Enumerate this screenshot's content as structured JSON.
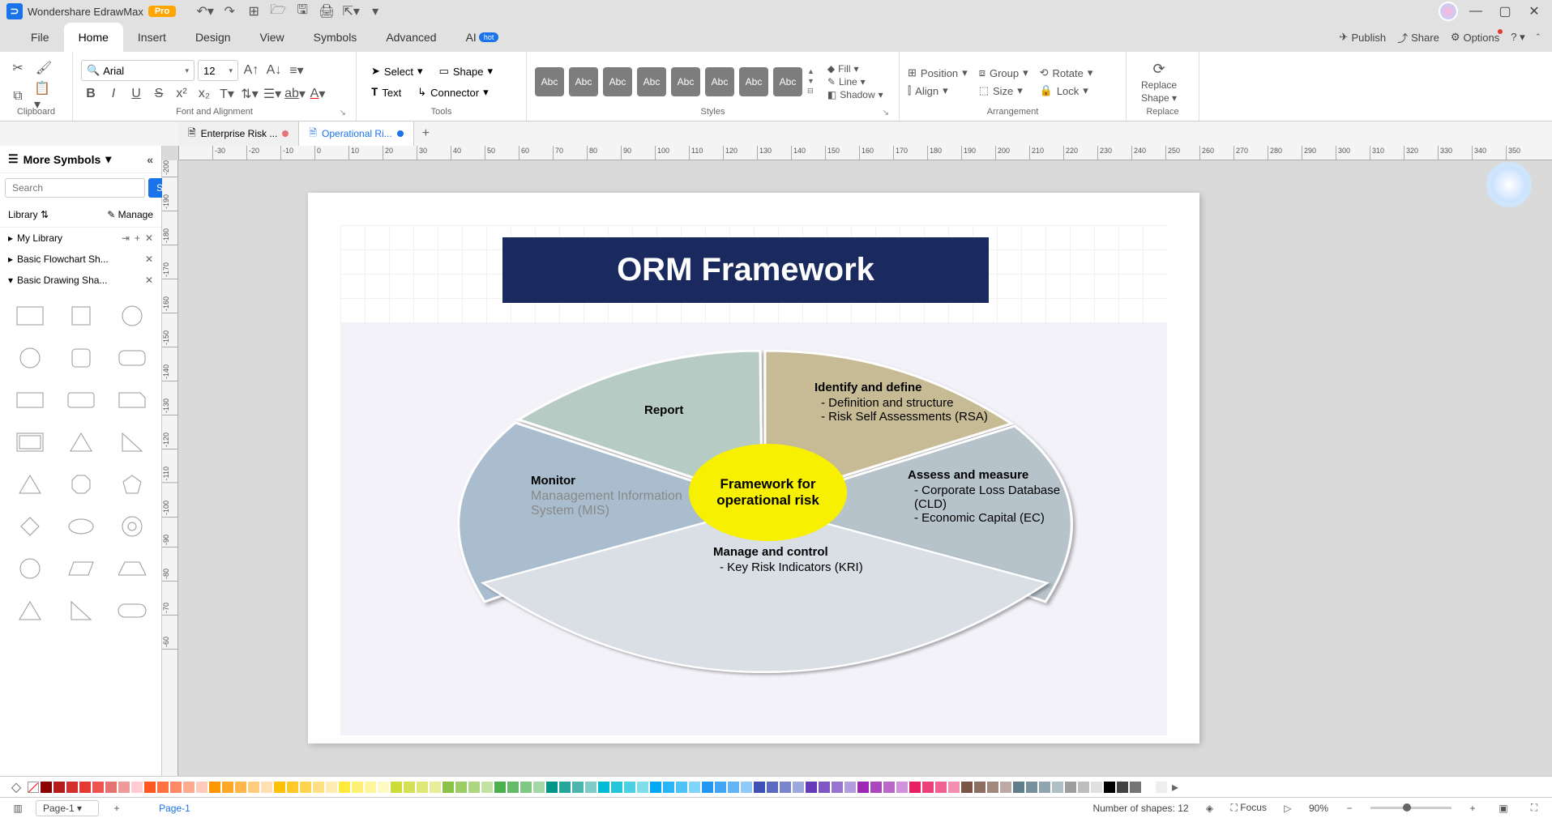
{
  "app": {
    "title": "Wondershare EdrawMax",
    "badge": "Pro"
  },
  "menubar": {
    "file": "File",
    "home": "Home",
    "insert": "Insert",
    "design": "Design",
    "view": "View",
    "symbols": "Symbols",
    "advanced": "Advanced",
    "ai": "AI",
    "hot": "hot",
    "publish": "Publish",
    "share": "Share",
    "options": "Options"
  },
  "ribbon": {
    "clipboard_label": "Clipboard",
    "font_label": "Font and Alignment",
    "font_name": "Arial",
    "font_size": "12",
    "tools_label": "Tools",
    "select": "Select",
    "shape": "Shape",
    "text": "Text",
    "connector": "Connector",
    "abc": "Abc",
    "styles_label": "Styles",
    "fill": "Fill",
    "line": "Line",
    "shadow": "Shadow",
    "arrangement_label": "Arrangement",
    "position": "Position",
    "align": "Align",
    "group": "Group",
    "size": "Size",
    "rotate": "Rotate",
    "lock": "Lock",
    "replace": "Replace",
    "replace_shape1": "Replace",
    "replace_shape2": "Shape"
  },
  "doc_tabs": {
    "t1": "Enterprise Risk ...",
    "t2": "Operational Ri..."
  },
  "left_panel": {
    "more_symbols": "More Symbols",
    "search_placeholder": "Search",
    "search_btn": "Search",
    "library": "Library",
    "manage": "Manage",
    "my_library": "My Library",
    "basic_flowchart": "Basic Flowchart Sh...",
    "basic_drawing": "Basic Drawing Sha..."
  },
  "diagram": {
    "title": "ORM Framework",
    "center": "Framework for operational risk",
    "report": "Report",
    "identify_hdr": "Identify and define",
    "identify_1": "Definition and structure",
    "identify_2": "Risk Self Assessments (RSA)",
    "monitor_hdr": "Monitor",
    "monitor_sub": "Manaagement Information System (MIS)",
    "assess_hdr": "Assess and measure",
    "assess_1": "Corporate Loss Database (CLD)",
    "assess_2": "Economic Capital (EC)",
    "manage_hdr": "Manage and control",
    "manage_1": "Key Risk Indicators (KRI)"
  },
  "status": {
    "page_sel": "Page-1",
    "page_tab": "Page-1",
    "shapes": "Number of shapes: 12",
    "focus": "Focus",
    "zoom": "90%"
  },
  "ruler_h": [
    "",
    "-30",
    "-20",
    "-10",
    "0",
    "10",
    "20",
    "30",
    "40",
    "50",
    "60",
    "70",
    "80",
    "90",
    "100",
    "110",
    "120",
    "130",
    "140",
    "150",
    "160",
    "170",
    "180",
    "190",
    "200",
    "210",
    "220",
    "230",
    "240",
    "250",
    "260",
    "270",
    "280",
    "290",
    "300",
    "310",
    "320",
    "330",
    "340",
    "350"
  ],
  "ruler_v": [
    "-200",
    "-190",
    "-180",
    "-170",
    "-160",
    "-150",
    "-140",
    "-130",
    "-120",
    "-110",
    "-100",
    "-90",
    "-80",
    "-70",
    "-60"
  ],
  "palette": [
    "#8b0000",
    "#b71c1c",
    "#d32f2f",
    "#e53935",
    "#ef5350",
    "#e57373",
    "#ef9a9a",
    "#ffcdd2",
    "#ff5722",
    "#ff7043",
    "#ff8a65",
    "#ffab91",
    "#ffccbc",
    "#ff9800",
    "#ffa726",
    "#ffb74d",
    "#ffcc80",
    "#ffe0b2",
    "#ffc107",
    "#ffca28",
    "#ffd54f",
    "#ffe082",
    "#ffecb3",
    "#ffeb3b",
    "#fff176",
    "#fff59d",
    "#fff9c4",
    "#cddc39",
    "#d4e157",
    "#dce775",
    "#e6ee9c",
    "#8bc34a",
    "#9ccc65",
    "#aed581",
    "#c5e1a5",
    "#4caf50",
    "#66bb6a",
    "#81c784",
    "#a5d6a7",
    "#009688",
    "#26a69a",
    "#4db6ac",
    "#80cbc4",
    "#00bcd4",
    "#26c6da",
    "#4dd0e1",
    "#80deea",
    "#03a9f4",
    "#29b6f6",
    "#4fc3f7",
    "#81d4fa",
    "#2196f3",
    "#42a5f5",
    "#64b5f6",
    "#90caf9",
    "#3f51b5",
    "#5c6bc0",
    "#7986cb",
    "#9fa8da",
    "#673ab7",
    "#7e57c2",
    "#9575cd",
    "#b39ddb",
    "#9c27b0",
    "#ab47bc",
    "#ba68c8",
    "#ce93d8",
    "#e91e63",
    "#ec407a",
    "#f06292",
    "#f48fb1",
    "#795548",
    "#8d6e63",
    "#a1887f",
    "#bcaaa4",
    "#607d8b",
    "#78909c",
    "#90a4ae",
    "#b0bec5",
    "#9e9e9e",
    "#bdbdbd",
    "#e0e0e0",
    "#000000",
    "#424242",
    "#757575",
    "#ffffff",
    "#eeeeee"
  ]
}
